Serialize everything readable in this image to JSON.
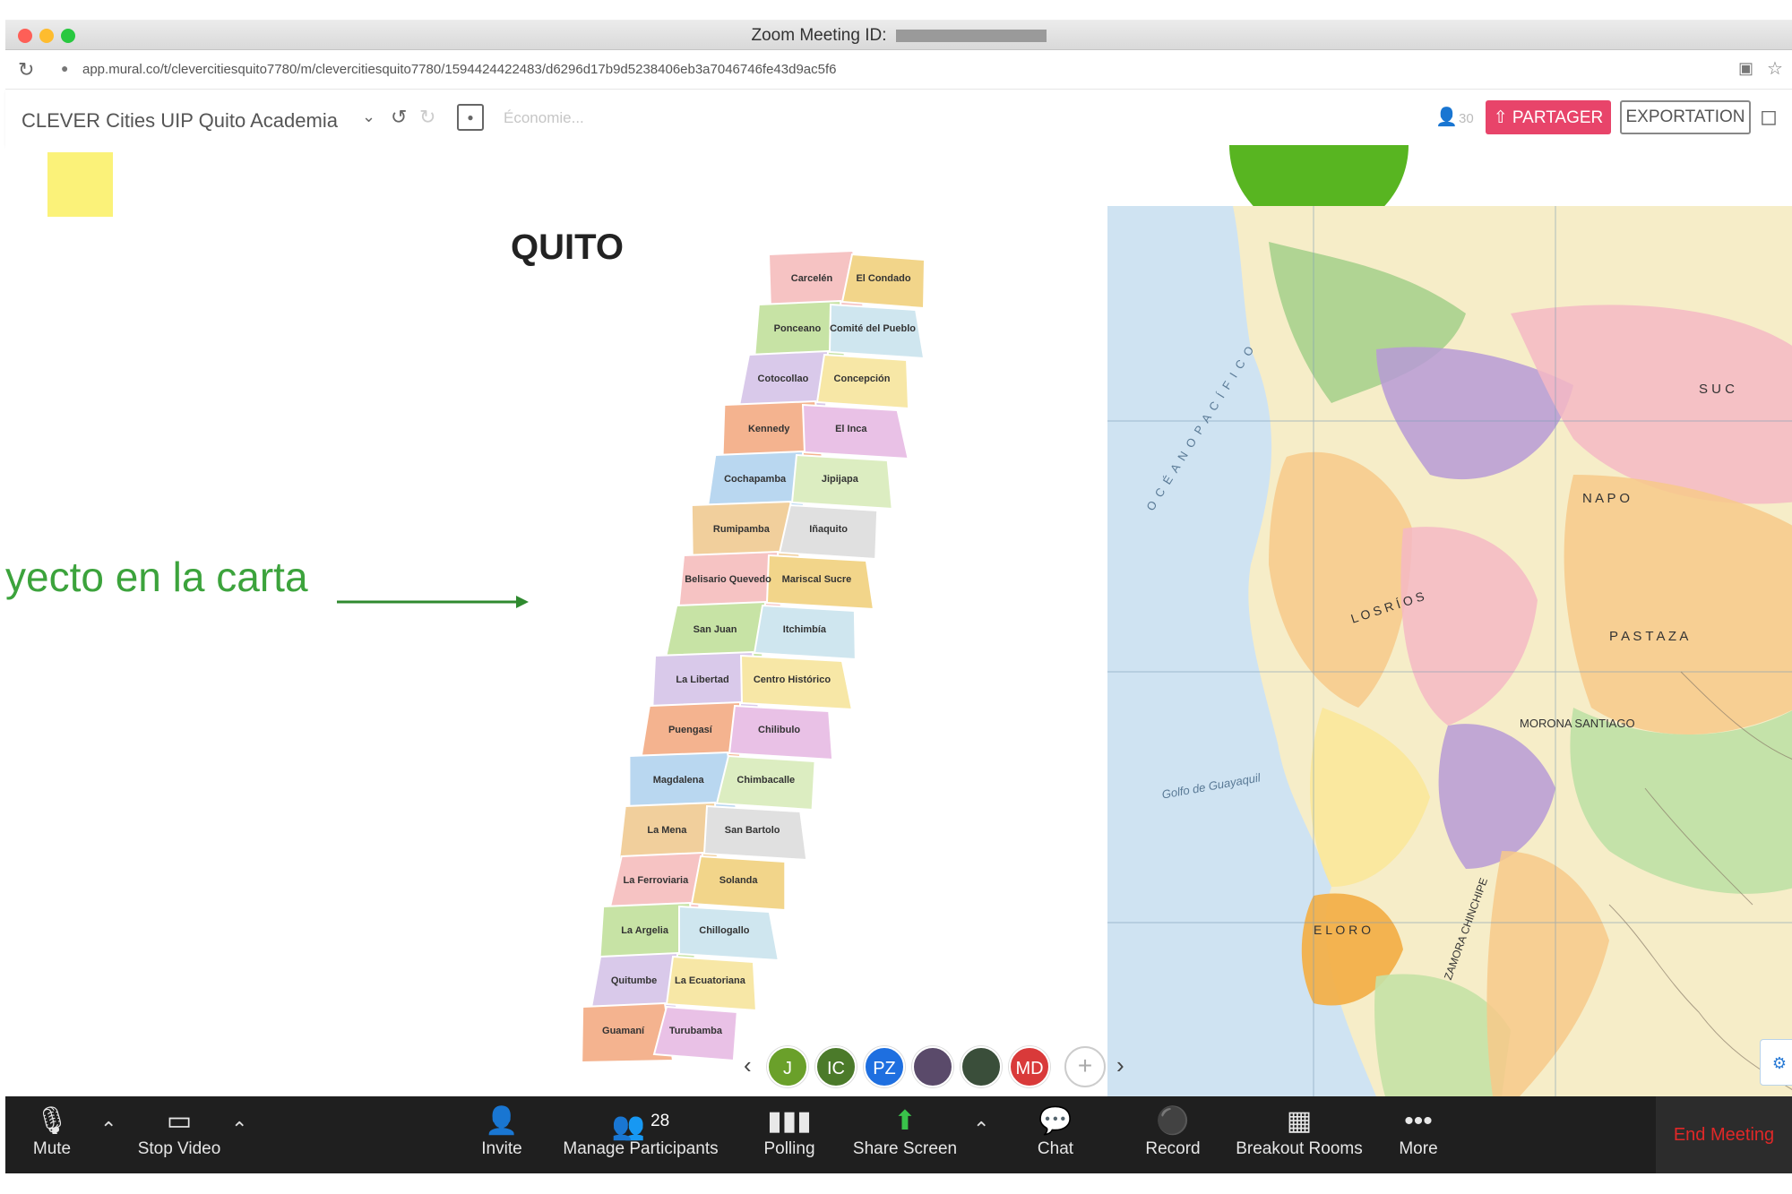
{
  "window": {
    "title": "Zoom Meeting ID:",
    "url": "app.mural.co/t/clevercitiesquito7780/m/clevercitiesquito7780/1594424422483/d6296d17b9d5238406eb3a7046746fe43d9ac5f6"
  },
  "mural_toolbar": {
    "board_title": "CLEVER Cities UIP Quito Academia",
    "search_placeholder": "Économie...",
    "participant_count": "30",
    "share_label": "PARTAGER",
    "export_label": "EXPORTATION"
  },
  "canvas": {
    "quito_title": "QUITO",
    "arrow_text": "yecto en la carta",
    "quito_parishes": [
      "Carcelén",
      "El Condado",
      "Ponceano",
      "Comité del Pueblo",
      "Cotocollao",
      "Concepción",
      "Kennedy",
      "El Inca",
      "Cochapamba",
      "Jipijapa",
      "Rumipamba",
      "Iñaquito",
      "Belisario Quevedo",
      "Mariscal Sucre",
      "San Juan",
      "Itchimbía",
      "La Libertad",
      "Centro Histórico",
      "Puengasí",
      "Chilibulo",
      "Magdalena",
      "Chimbacalle",
      "La Mena",
      "San Bartolo",
      "La Ferroviaria",
      "Solanda",
      "La Argelia",
      "Chillogallo",
      "Quitumbe",
      "La Ecuatoriana",
      "Guamaní",
      "Turubamba"
    ],
    "ecuador_labels": [
      "O C É A N O   P A C Í F I C O",
      "N A P O",
      "P A S T A Z A",
      "MORONA SANTIAGO",
      "L O S   R Í O S",
      "E L   O R O",
      "Golfo de Guayaquil",
      "ZAMORA CHINCHIPE",
      "S U C"
    ]
  },
  "participants": [
    {
      "initials": "J",
      "color": "#6aa02a"
    },
    {
      "initials": "IC",
      "color": "#4b7a2a"
    },
    {
      "initials": "PZ",
      "color": "#1e6fe0"
    },
    {
      "initials": "",
      "color": "#5a4a6a"
    },
    {
      "initials": "",
      "color": "#3a4e3a"
    },
    {
      "initials": "MD",
      "color": "#d93a3a"
    }
  ],
  "zoom_controls": {
    "mute": "Mute",
    "stop_video": "Stop Video",
    "invite": "Invite",
    "manage_participants": "Manage Participants",
    "participant_count": "28",
    "polling": "Polling",
    "share_screen": "Share Screen",
    "chat": "Chat",
    "record": "Record",
    "breakout_rooms": "Breakout Rooms",
    "more": "More",
    "end_meeting": "End Meeting"
  },
  "colors": {
    "share_button": "#e8446a",
    "zoom_bar": "#1f1f1f",
    "end_meeting_text": "#e02828",
    "accent_green": "#3ca33c",
    "sticky_note": "#fbf279"
  },
  "icons": [
    "mic-icon",
    "video-camera-icon",
    "add-user-icon",
    "participants-icon",
    "bar-chart-icon",
    "share-screen-icon",
    "chat-bubble-icon",
    "record-icon",
    "grid-icon",
    "ellipsis-icon"
  ]
}
